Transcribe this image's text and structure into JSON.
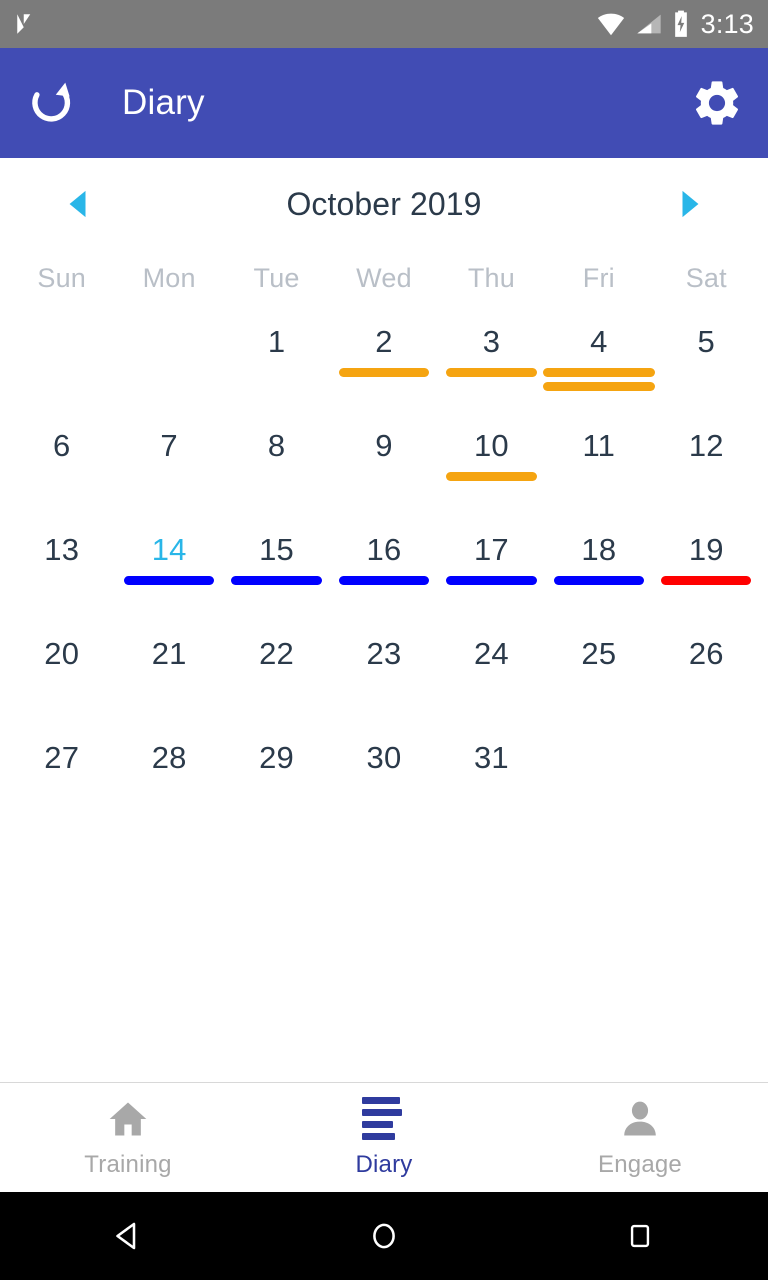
{
  "status_bar": {
    "time": "3:13",
    "icons": [
      "app-notification-icon",
      "wifi-icon",
      "cellular-signal-icon",
      "battery-charging-icon"
    ],
    "background_color": "#7b7b7b"
  },
  "app_bar": {
    "title": "Diary",
    "refresh_label": "refresh-icon",
    "settings_label": "settings-gear-icon",
    "background_color": "#414cb4",
    "text_color": "#ffffff"
  },
  "calendar": {
    "month_title": "October 2019",
    "prev_arrow": "◀",
    "next_arrow": "▶",
    "arrow_color": "#29b6e8",
    "weekdays": [
      "Sun",
      "Mon",
      "Tue",
      "Wed",
      "Thu",
      "Fri",
      "Sat"
    ],
    "today": 14,
    "today_color": "#29b6e8",
    "day_text_color": "#2b3a4a",
    "marker_colors": {
      "orange": "#f5a411",
      "blue": "#0000ff",
      "red": "#ff0000"
    },
    "weeks": [
      [
        {
          "day": "",
          "markers": []
        },
        {
          "day": "",
          "markers": []
        },
        {
          "day": "1",
          "markers": []
        },
        {
          "day": "2",
          "markers": [
            "orange"
          ]
        },
        {
          "day": "3",
          "markers": [
            "orange"
          ]
        },
        {
          "day": "4",
          "markers": [
            "orange",
            "orange"
          ],
          "wide": true
        },
        {
          "day": "5",
          "markers": []
        }
      ],
      [
        {
          "day": "6",
          "markers": []
        },
        {
          "day": "7",
          "markers": []
        },
        {
          "day": "8",
          "markers": []
        },
        {
          "day": "9",
          "markers": []
        },
        {
          "day": "10",
          "markers": [
            "orange"
          ]
        },
        {
          "day": "11",
          "markers": []
        },
        {
          "day": "12",
          "markers": []
        }
      ],
      [
        {
          "day": "13",
          "markers": []
        },
        {
          "day": "14",
          "markers": [
            "blue"
          ]
        },
        {
          "day": "15",
          "markers": [
            "blue"
          ]
        },
        {
          "day": "16",
          "markers": [
            "blue"
          ]
        },
        {
          "day": "17",
          "markers": [
            "blue"
          ]
        },
        {
          "day": "18",
          "markers": [
            "blue"
          ]
        },
        {
          "day": "19",
          "markers": [
            "red"
          ]
        }
      ],
      [
        {
          "day": "20",
          "markers": []
        },
        {
          "day": "21",
          "markers": []
        },
        {
          "day": "22",
          "markers": []
        },
        {
          "day": "23",
          "markers": []
        },
        {
          "day": "24",
          "markers": []
        },
        {
          "day": "25",
          "markers": []
        },
        {
          "day": "26",
          "markers": []
        }
      ],
      [
        {
          "day": "27",
          "markers": []
        },
        {
          "day": "28",
          "markers": []
        },
        {
          "day": "29",
          "markers": []
        },
        {
          "day": "30",
          "markers": []
        },
        {
          "day": "31",
          "markers": []
        },
        {
          "day": "",
          "markers": []
        },
        {
          "day": "",
          "markers": []
        }
      ]
    ]
  },
  "tab_bar": {
    "active_index": 1,
    "active_color": "#2f3b9e",
    "inactive_color": "#a8a8a8",
    "items": [
      {
        "label": "Training",
        "icon": "home-icon"
      },
      {
        "label": "Diary",
        "icon": "list-icon"
      },
      {
        "label": "Engage",
        "icon": "person-icon"
      }
    ]
  },
  "nav_bar": {
    "buttons": [
      {
        "name": "back-button",
        "icon": "triangle-left-icon"
      },
      {
        "name": "home-button",
        "icon": "circle-icon"
      },
      {
        "name": "recents-button",
        "icon": "square-icon"
      }
    ],
    "background_color": "#000000"
  }
}
